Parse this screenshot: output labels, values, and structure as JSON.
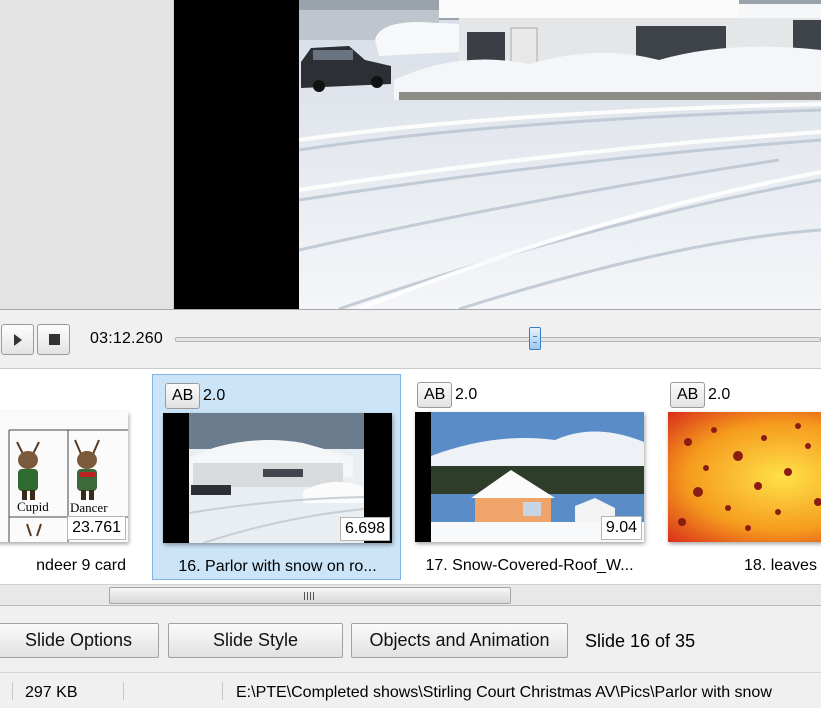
{
  "transport": {
    "play_icon": "play-icon",
    "stop_icon": "stop-icon",
    "current_time": "03:12.260",
    "timeline_position": 0.56
  },
  "slides": [
    {
      "index": "15",
      "transition_badge": "",
      "transition_duration": "",
      "duration": "23.761",
      "name": "ndeer 9 card",
      "thumb_labels": [
        "Cupid",
        "Dancer"
      ],
      "selected": false
    },
    {
      "index": "16",
      "transition_badge": "AB",
      "transition_duration": "2.0",
      "duration": "6.698",
      "name": "16. Parlor with snow on ro...",
      "selected": true
    },
    {
      "index": "17",
      "transition_badge": "AB",
      "transition_duration": "2.0",
      "duration": "9.04",
      "name": "17. Snow-Covered-Roof_W...",
      "selected": false
    },
    {
      "index": "18",
      "transition_badge": "AB",
      "transition_duration": "2.0",
      "duration": "",
      "name": "18. leaves",
      "selected": false
    }
  ],
  "buttons": {
    "slide_options": "Slide Options",
    "slide_style": "Slide Style",
    "objects_animation": "Objects and Animation"
  },
  "slide_counter": "Slide 16 of 35",
  "status": {
    "file_size": "297 KB",
    "file_path": "E:\\PTE\\Completed shows\\Stirling Court Christmas AV\\Pics\\Parlor with snow"
  },
  "colors": {
    "selection_bg": "#cce4f7",
    "selection_border": "#7eb4ea",
    "slider_thumb": "#9cc8ef"
  }
}
